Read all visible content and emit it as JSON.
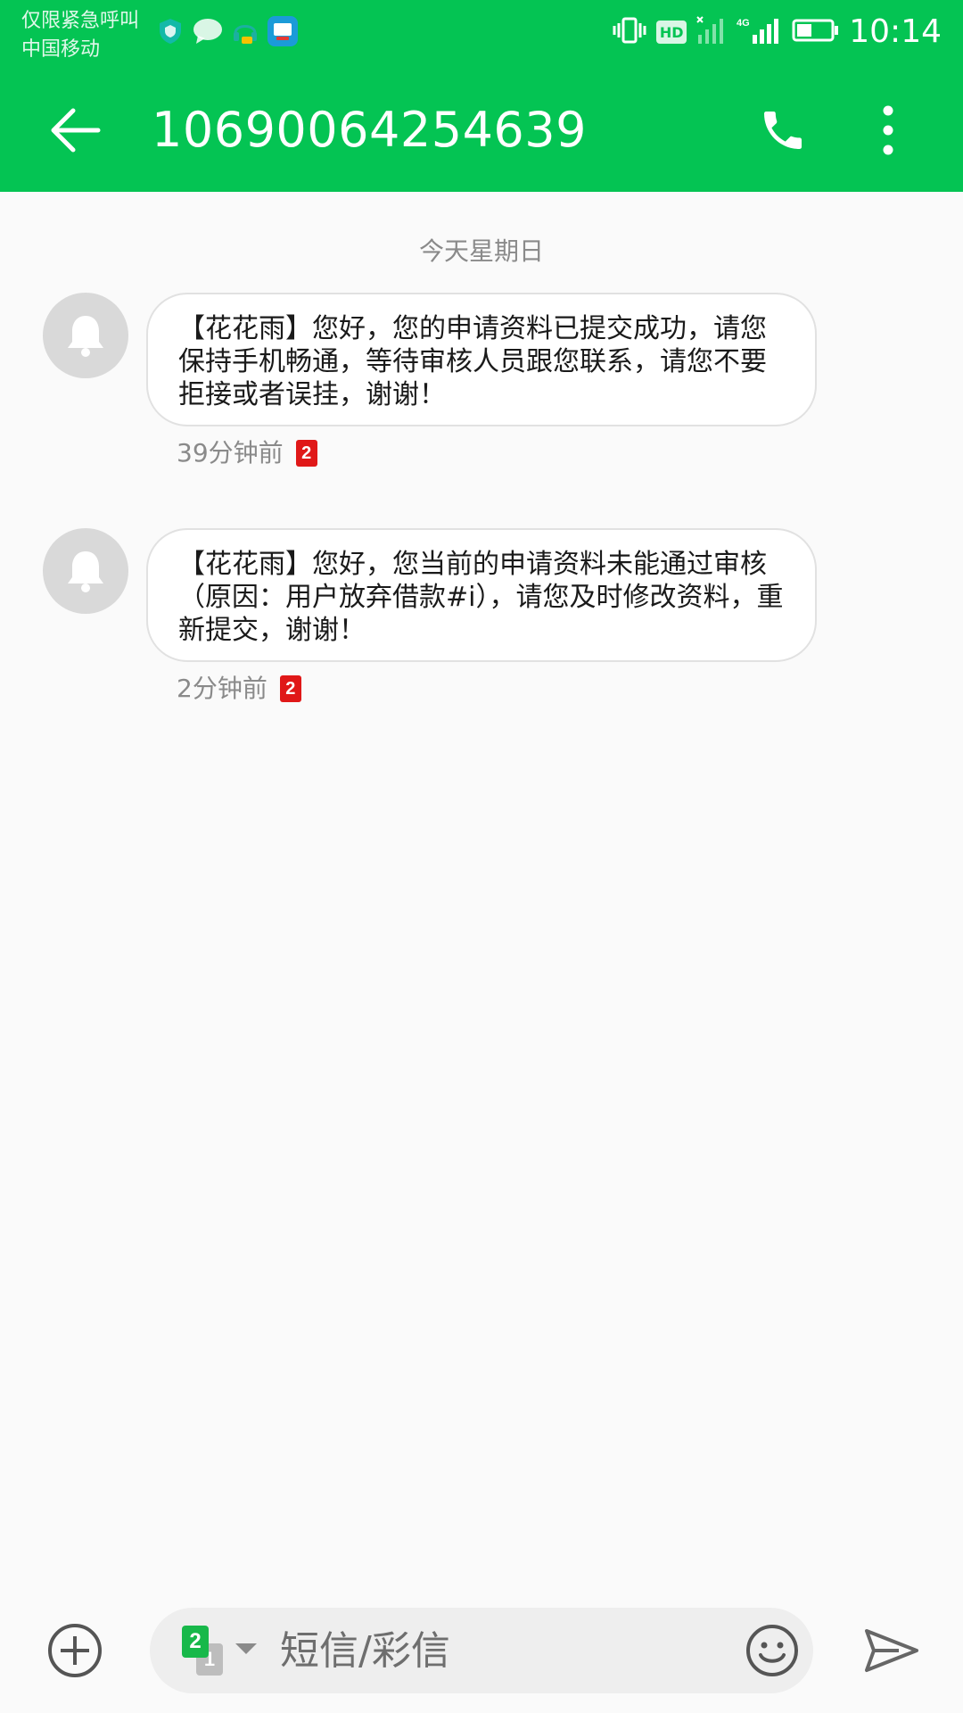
{
  "status_bar": {
    "carrier_line1": "仅限紧急呼叫",
    "carrier_line2": "中国移动",
    "app_icons": [
      "shield-icon",
      "chat-bubble-icon",
      "headset-icon",
      "rong-app-icon"
    ],
    "hd_label": "HD",
    "network": "4G",
    "time": "10:14"
  },
  "header": {
    "title": "10690064254639",
    "back_icon": "arrow-left-icon",
    "call_icon": "phone-icon",
    "more_icon": "more-vertical-icon"
  },
  "conversation": {
    "date_label": "今天星期日",
    "messages": [
      {
        "text": "【花花雨】您好，您的申请资料已提交成功，请您保持手机畅通，等待审核人员跟您联系，请您不要拒接或者误挂，谢谢！",
        "time": "39分钟前",
        "sim": "2"
      },
      {
        "text": "【花花雨】您好，您当前的申请资料未能通过审核（原因：用户放弃借款#i），请您及时修改资料，重新提交，谢谢！",
        "time": "2分钟前",
        "sim": "2"
      }
    ]
  },
  "composer": {
    "placeholder": "短信/彩信",
    "sim_primary": "2",
    "sim_secondary": "1"
  },
  "colors": {
    "brand_green": "#04c453",
    "sim_badge_red": "#e01818",
    "sim_green": "#18b84a"
  }
}
